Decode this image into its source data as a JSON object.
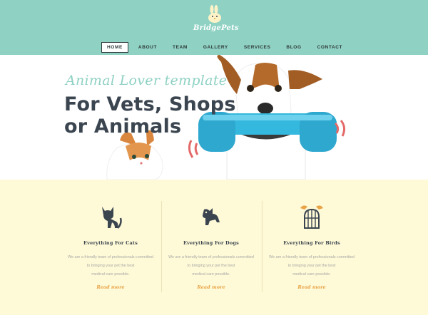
{
  "brand": {
    "logo_text": "BridgePets"
  },
  "nav": {
    "items": [
      "HOME",
      "ABOUT",
      "TEAM",
      "GALLERY",
      "SERVICES",
      "BLOG",
      "CONTACT"
    ],
    "active": "HOME"
  },
  "hero": {
    "tagline": "Animal Lover template",
    "title_line1": "For Vets, Shops",
    "title_line2": "or Animals"
  },
  "features": [
    {
      "icon": "cat-icon",
      "title": "Everything For Cats",
      "text_line1": "We are a friendly team of professionals committed",
      "text_line2": "to bringing your pet the best",
      "text_line3": "medical care possible.",
      "link": "Read more"
    },
    {
      "icon": "dog-icon",
      "title": "Everything For Dogs",
      "text_line1": "We are a friendly team of professionals committed",
      "text_line2": "to bringing your pet the best",
      "text_line3": "medical care possible.",
      "link": "Read more"
    },
    {
      "icon": "birdcage-icon",
      "title": "Everything For Birds",
      "text_line1": "We are a friendly team of professionals committed",
      "text_line2": "to bringing your pet the best",
      "text_line3": "medical care possible.",
      "link": "Read more"
    }
  ],
  "colors": {
    "header_bg": "#8fd1c3",
    "features_bg": "#fef9d6",
    "accent_link": "#e8a347",
    "title_text": "#3b4550",
    "phone_blue": "#35b8de"
  }
}
